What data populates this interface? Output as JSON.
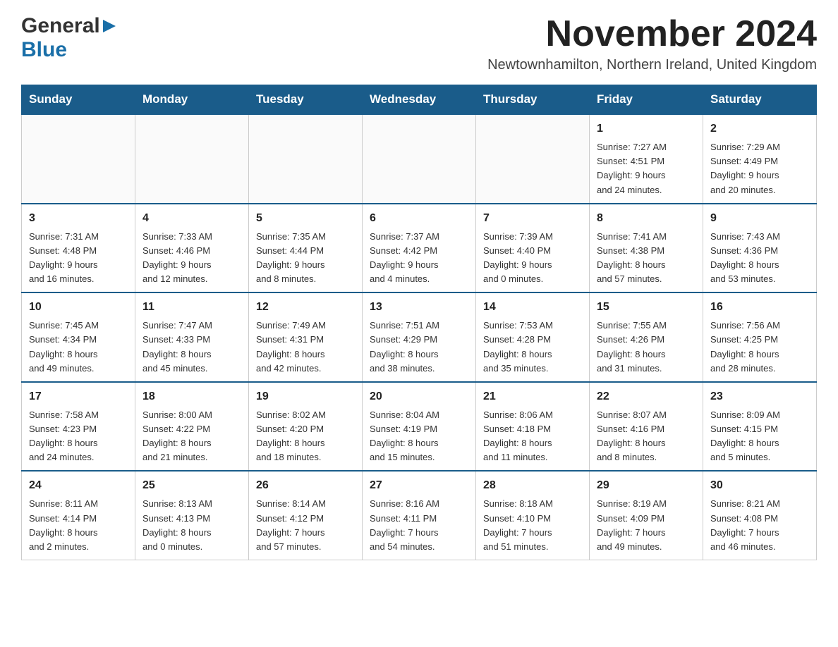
{
  "logo": {
    "general": "General",
    "blue": "Blue",
    "triangle": "▶"
  },
  "header": {
    "month_title": "November 2024",
    "location": "Newtownhamilton, Northern Ireland, United Kingdom"
  },
  "days_of_week": [
    "Sunday",
    "Monday",
    "Tuesday",
    "Wednesday",
    "Thursday",
    "Friday",
    "Saturday"
  ],
  "weeks": [
    [
      {
        "day": "",
        "info": ""
      },
      {
        "day": "",
        "info": ""
      },
      {
        "day": "",
        "info": ""
      },
      {
        "day": "",
        "info": ""
      },
      {
        "day": "",
        "info": ""
      },
      {
        "day": "1",
        "info": "Sunrise: 7:27 AM\nSunset: 4:51 PM\nDaylight: 9 hours\nand 24 minutes."
      },
      {
        "day": "2",
        "info": "Sunrise: 7:29 AM\nSunset: 4:49 PM\nDaylight: 9 hours\nand 20 minutes."
      }
    ],
    [
      {
        "day": "3",
        "info": "Sunrise: 7:31 AM\nSunset: 4:48 PM\nDaylight: 9 hours\nand 16 minutes."
      },
      {
        "day": "4",
        "info": "Sunrise: 7:33 AM\nSunset: 4:46 PM\nDaylight: 9 hours\nand 12 minutes."
      },
      {
        "day": "5",
        "info": "Sunrise: 7:35 AM\nSunset: 4:44 PM\nDaylight: 9 hours\nand 8 minutes."
      },
      {
        "day": "6",
        "info": "Sunrise: 7:37 AM\nSunset: 4:42 PM\nDaylight: 9 hours\nand 4 minutes."
      },
      {
        "day": "7",
        "info": "Sunrise: 7:39 AM\nSunset: 4:40 PM\nDaylight: 9 hours\nand 0 minutes."
      },
      {
        "day": "8",
        "info": "Sunrise: 7:41 AM\nSunset: 4:38 PM\nDaylight: 8 hours\nand 57 minutes."
      },
      {
        "day": "9",
        "info": "Sunrise: 7:43 AM\nSunset: 4:36 PM\nDaylight: 8 hours\nand 53 minutes."
      }
    ],
    [
      {
        "day": "10",
        "info": "Sunrise: 7:45 AM\nSunset: 4:34 PM\nDaylight: 8 hours\nand 49 minutes."
      },
      {
        "day": "11",
        "info": "Sunrise: 7:47 AM\nSunset: 4:33 PM\nDaylight: 8 hours\nand 45 minutes."
      },
      {
        "day": "12",
        "info": "Sunrise: 7:49 AM\nSunset: 4:31 PM\nDaylight: 8 hours\nand 42 minutes."
      },
      {
        "day": "13",
        "info": "Sunrise: 7:51 AM\nSunset: 4:29 PM\nDaylight: 8 hours\nand 38 minutes."
      },
      {
        "day": "14",
        "info": "Sunrise: 7:53 AM\nSunset: 4:28 PM\nDaylight: 8 hours\nand 35 minutes."
      },
      {
        "day": "15",
        "info": "Sunrise: 7:55 AM\nSunset: 4:26 PM\nDaylight: 8 hours\nand 31 minutes."
      },
      {
        "day": "16",
        "info": "Sunrise: 7:56 AM\nSunset: 4:25 PM\nDaylight: 8 hours\nand 28 minutes."
      }
    ],
    [
      {
        "day": "17",
        "info": "Sunrise: 7:58 AM\nSunset: 4:23 PM\nDaylight: 8 hours\nand 24 minutes."
      },
      {
        "day": "18",
        "info": "Sunrise: 8:00 AM\nSunset: 4:22 PM\nDaylight: 8 hours\nand 21 minutes."
      },
      {
        "day": "19",
        "info": "Sunrise: 8:02 AM\nSunset: 4:20 PM\nDaylight: 8 hours\nand 18 minutes."
      },
      {
        "day": "20",
        "info": "Sunrise: 8:04 AM\nSunset: 4:19 PM\nDaylight: 8 hours\nand 15 minutes."
      },
      {
        "day": "21",
        "info": "Sunrise: 8:06 AM\nSunset: 4:18 PM\nDaylight: 8 hours\nand 11 minutes."
      },
      {
        "day": "22",
        "info": "Sunrise: 8:07 AM\nSunset: 4:16 PM\nDaylight: 8 hours\nand 8 minutes."
      },
      {
        "day": "23",
        "info": "Sunrise: 8:09 AM\nSunset: 4:15 PM\nDaylight: 8 hours\nand 5 minutes."
      }
    ],
    [
      {
        "day": "24",
        "info": "Sunrise: 8:11 AM\nSunset: 4:14 PM\nDaylight: 8 hours\nand 2 minutes."
      },
      {
        "day": "25",
        "info": "Sunrise: 8:13 AM\nSunset: 4:13 PM\nDaylight: 8 hours\nand 0 minutes."
      },
      {
        "day": "26",
        "info": "Sunrise: 8:14 AM\nSunset: 4:12 PM\nDaylight: 7 hours\nand 57 minutes."
      },
      {
        "day": "27",
        "info": "Sunrise: 8:16 AM\nSunset: 4:11 PM\nDaylight: 7 hours\nand 54 minutes."
      },
      {
        "day": "28",
        "info": "Sunrise: 8:18 AM\nSunset: 4:10 PM\nDaylight: 7 hours\nand 51 minutes."
      },
      {
        "day": "29",
        "info": "Sunrise: 8:19 AM\nSunset: 4:09 PM\nDaylight: 7 hours\nand 49 minutes."
      },
      {
        "day": "30",
        "info": "Sunrise: 8:21 AM\nSunset: 4:08 PM\nDaylight: 7 hours\nand 46 minutes."
      }
    ]
  ]
}
